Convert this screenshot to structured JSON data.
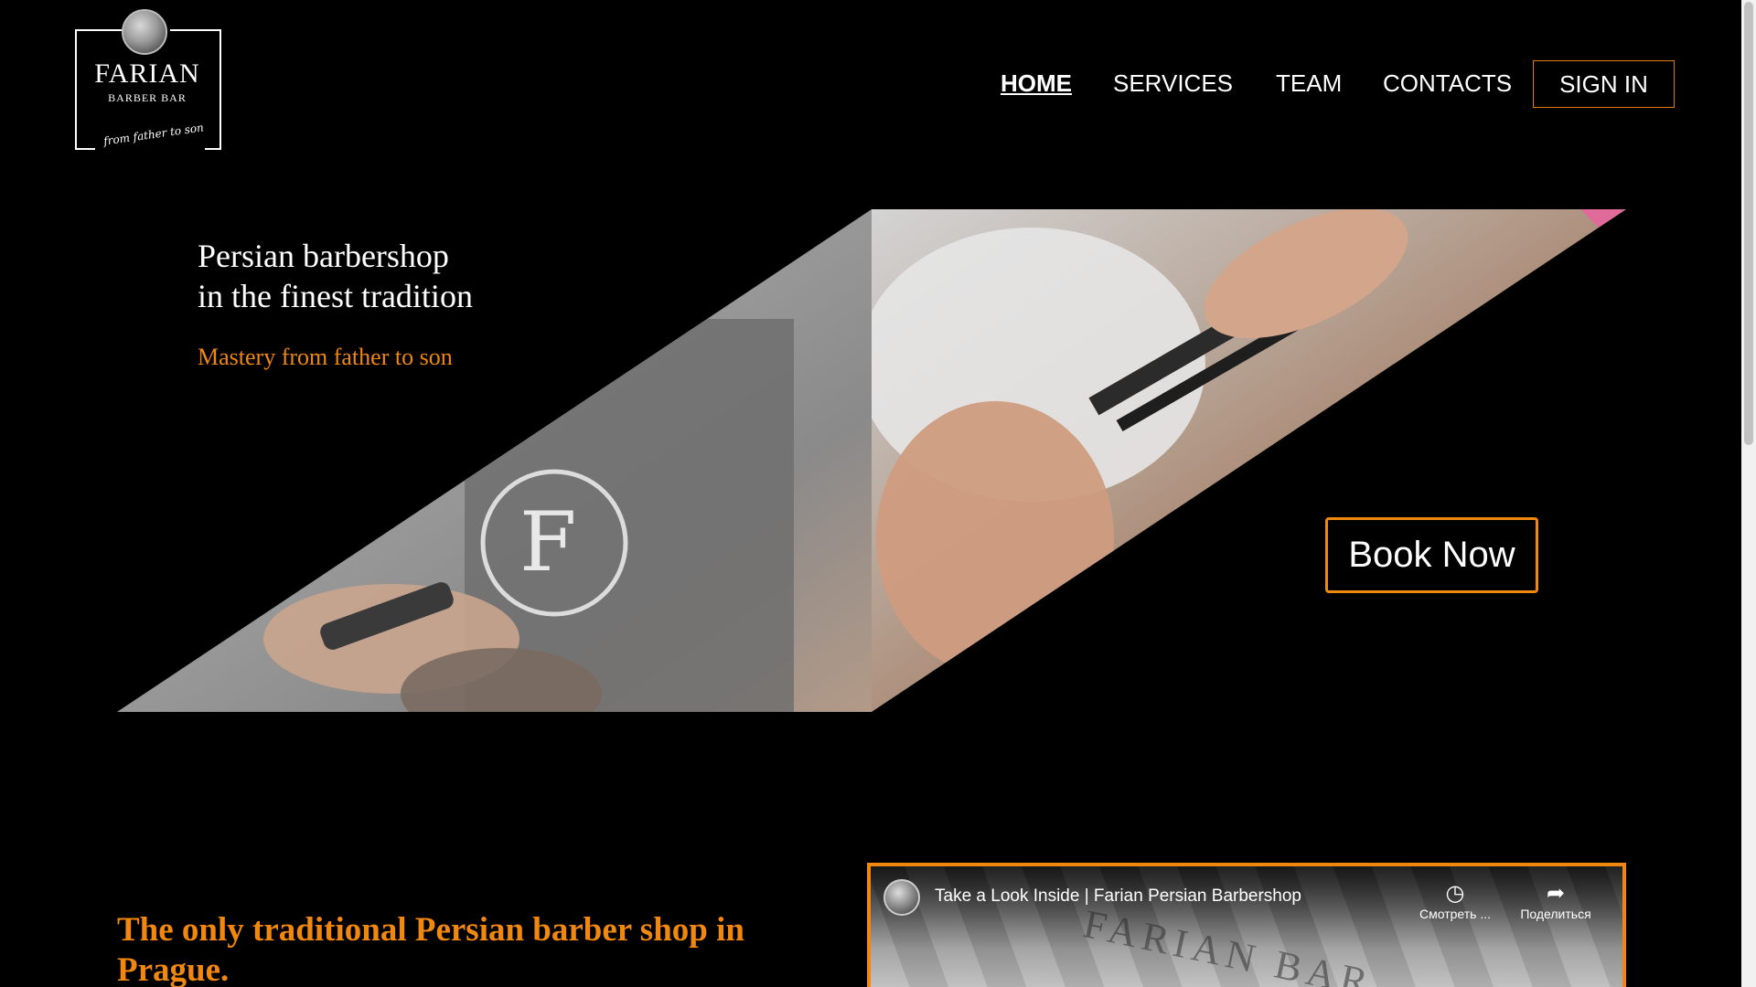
{
  "logo": {
    "brand": "FARIAN",
    "sub": "BARBER BAR",
    "tagline": "from father to son"
  },
  "nav": {
    "items": [
      "HOME",
      "SERVICES",
      "TEAM",
      "CONTACTS"
    ],
    "active": "HOME",
    "signin": "SIGN IN"
  },
  "hero": {
    "title_line1": "Persian barbershop",
    "title_line2": "in the finest tradition",
    "subtitle": "Mastery from father to son",
    "cta": "Book Now"
  },
  "section": {
    "heading": "The only traditional Persian barber shop in Prague."
  },
  "video": {
    "title": "Take a Look Inside | Farian Persian Barbershop",
    "watch_later": "Смотреть ...",
    "share": "Поделиться",
    "watch_icon": "clock-icon",
    "share_icon": "share-arrow-icon"
  },
  "colors": {
    "accent": "#f0870f",
    "background": "#000000",
    "text": "#ffffff"
  }
}
